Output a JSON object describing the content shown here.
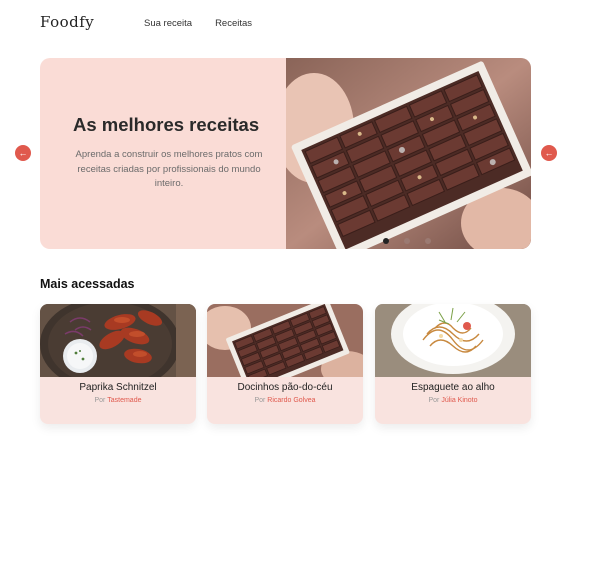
{
  "header": {
    "logo": "Foodfy",
    "nav": [
      "Sua receita",
      "Receitas"
    ]
  },
  "hero": {
    "title": "As melhores receitas",
    "description": "Aprenda a construir os melhores pratos com receitas criadas por profissionais do mundo inteiro.",
    "image": "chocolate-box-photo",
    "slides_count": 3,
    "active_slide": 0
  },
  "carousel": {
    "prev_icon": "arrow-left-icon",
    "next_icon": "arrow-right-icon",
    "accent": "#e0594d"
  },
  "section": {
    "title": "Mais acessadas"
  },
  "recipes": [
    {
      "name": "Paprika Schnitzel",
      "by": "Por",
      "author": "Tastemade",
      "image": "chicken-wings-photo"
    },
    {
      "name": "Docinhos pão-do-céu",
      "by": "Por",
      "author": "Ricardo Golvea",
      "image": "chocolate-box-photo"
    },
    {
      "name": "Espaguete ao alho",
      "by": "Por",
      "author": "Júlia Kinoto",
      "image": "spaghetti-plate-photo"
    }
  ],
  "colors": {
    "hero_bg": "#fadcd6",
    "card_bg": "#f9e3df",
    "accent": "#e0594d"
  }
}
